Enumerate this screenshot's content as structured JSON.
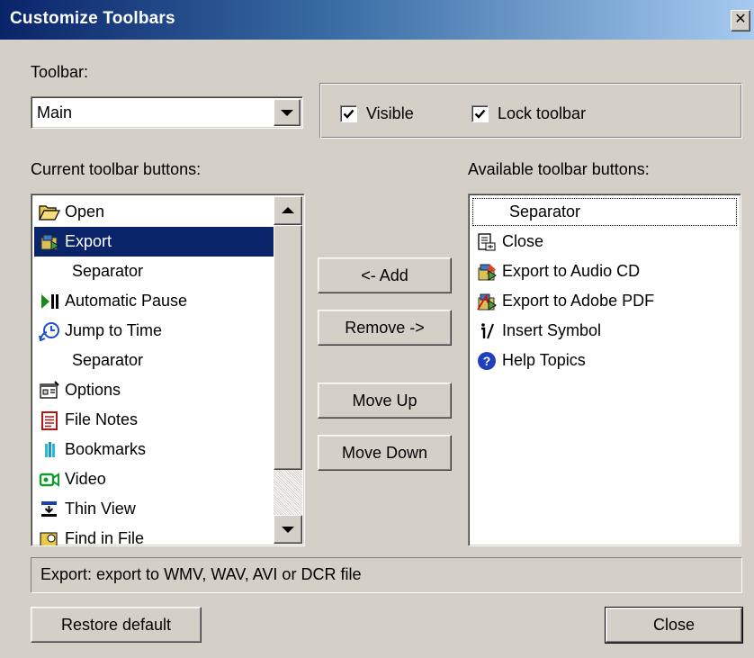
{
  "dialog": {
    "title": "Customize Toolbars"
  },
  "toolbar_select": {
    "label": "Toolbar:",
    "value": "Main"
  },
  "options": {
    "visible_label": "Visible",
    "visible_checked": true,
    "lock_label": "Lock toolbar",
    "lock_checked": true
  },
  "current_list": {
    "label": "Current toolbar buttons:",
    "items": [
      {
        "label": "Open",
        "icon": "open-folder-icon"
      },
      {
        "label": "Export",
        "icon": "export-icon",
        "selected": true
      },
      {
        "label": "Separator",
        "icon": ""
      },
      {
        "label": "Automatic Pause",
        "icon": "play-pause-icon"
      },
      {
        "label": "Jump to Time",
        "icon": "jump-to-time-icon"
      },
      {
        "label": "Separator",
        "icon": ""
      },
      {
        "label": "Options",
        "icon": "options-icon"
      },
      {
        "label": "File Notes",
        "icon": "file-notes-icon"
      },
      {
        "label": "Bookmarks",
        "icon": "bookmarks-icon"
      },
      {
        "label": "Video",
        "icon": "video-icon"
      },
      {
        "label": "Thin View",
        "icon": "thin-view-icon"
      },
      {
        "label": "Find in File",
        "icon": "find-in-file-icon"
      }
    ]
  },
  "available_list": {
    "label": "Available toolbar buttons:",
    "items": [
      {
        "label": "Separator",
        "icon": "",
        "focused": true
      },
      {
        "label": "Close",
        "icon": "close-doc-icon"
      },
      {
        "label": "Export to Audio CD",
        "icon": "export-audio-cd-icon"
      },
      {
        "label": "Export to Adobe PDF",
        "icon": "export-pdf-icon"
      },
      {
        "label": "Insert Symbol",
        "icon": "insert-symbol-icon"
      },
      {
        "label": "Help Topics",
        "icon": "help-icon"
      }
    ]
  },
  "actions": {
    "add_label": "<- Add",
    "remove_label": "Remove ->",
    "move_up_label": "Move Up",
    "move_down_label": "Move Down"
  },
  "status": {
    "text": "Export: export to WMV, WAV, AVI or DCR file"
  },
  "footer": {
    "restore_label": "Restore default",
    "close_label": "Close"
  },
  "colors": {
    "dialog_bg": "#d4d0c8",
    "title_start": "#0a246a",
    "title_end": "#a6caf0",
    "selection": "#0a246a"
  }
}
